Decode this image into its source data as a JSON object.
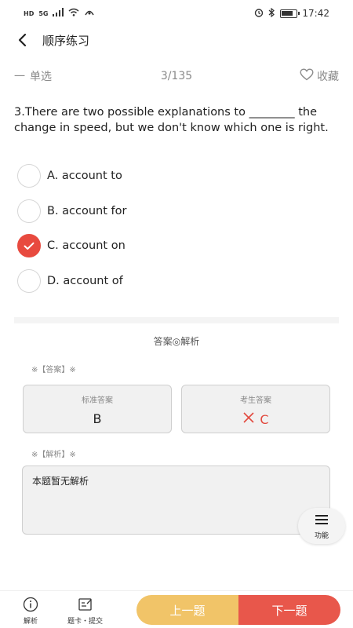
{
  "status": {
    "network_hd": "HD",
    "network_gen": "5G",
    "time": "17:42"
  },
  "header": {
    "title": "顺序练习"
  },
  "subheader": {
    "type_prefix": "一",
    "type_label": "单选",
    "progress": "3/135",
    "favorite_label": "收藏"
  },
  "question": {
    "text": "3.There are two possible explanations to ________ the change in speed, but we don't know which one is right.",
    "options": [
      {
        "label": "A. account to",
        "selected": false
      },
      {
        "label": "B. account for",
        "selected": false
      },
      {
        "label": "C. account on",
        "selected": true
      },
      {
        "label": "D. account of",
        "selected": false
      }
    ]
  },
  "analysis_section": {
    "title": "答案◎解析",
    "answer_tag": "※【答案】※",
    "standard_caption": "标准答案",
    "standard_value": "B",
    "user_caption": "考生答案",
    "user_value": "C",
    "analysis_tag": "※【解析】※",
    "analysis_text": "本题暂无解析"
  },
  "fab": {
    "label": "功能"
  },
  "bottombar": {
    "explain_label": "解析",
    "card_label": "题卡・提交",
    "prev_label": "上一题",
    "next_label": "下一题"
  },
  "colors": {
    "accent_red": "#e8574b",
    "accent_yellow": "#f1c468"
  },
  "icons": {
    "back": "back-chevron-icon",
    "favorite": "heart-outline-icon",
    "selected": "check-icon",
    "wrong": "cross-icon",
    "menu": "menu-icon",
    "info": "info-icon",
    "card": "edit-card-icon"
  }
}
